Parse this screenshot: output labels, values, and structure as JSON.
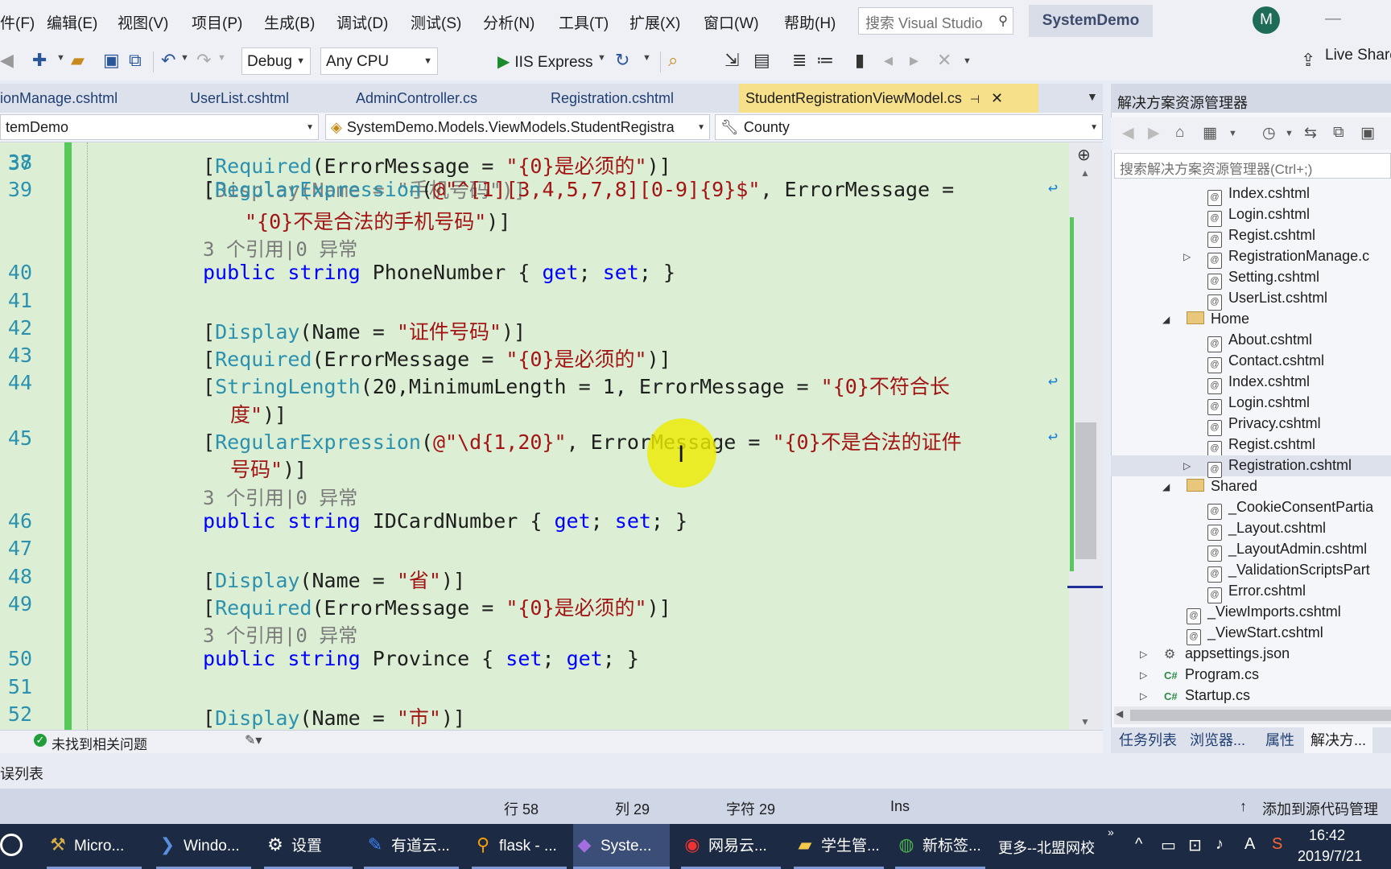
{
  "menu": {
    "items": [
      "件(F)",
      "编辑(E)",
      "视图(V)",
      "项目(P)",
      "生成(B)",
      "调试(D)",
      "测试(S)",
      "分析(N)",
      "工具(T)",
      "扩展(X)",
      "窗口(W)",
      "帮助(H)"
    ],
    "search_placeholder": "搜索 Visual Studio",
    "solution_name": "SystemDemo",
    "avatar_initial": "M"
  },
  "toolbar": {
    "config": "Debug",
    "platform": "Any CPU",
    "run_target": "IIS Express",
    "live_share": "Live Share"
  },
  "tabs": [
    {
      "label": "ionManage.cshtml",
      "active": false
    },
    {
      "label": "UserList.cshtml",
      "active": false
    },
    {
      "label": "AdminController.cs",
      "active": false
    },
    {
      "label": "Registration.cshtml",
      "active": false
    },
    {
      "label": "StudentRegistrationViewModel.cs",
      "active": true
    }
  ],
  "navbar": {
    "project": "temDemo",
    "type": "SystemDemo.Models.ViewModels.StudentRegistra",
    "member": "County"
  },
  "code": {
    "partial_top": "[Display(Name = \"手机号码\")]",
    "lines": [
      {
        "num": "38",
        "parts": [
          [
            "pl",
            "["
          ],
          [
            "attr",
            "Required"
          ],
          [
            "pl",
            "(ErrorMessage = "
          ],
          [
            "str",
            "\"{0}是必须的\""
          ],
          [
            "pl",
            ")]"
          ]
        ]
      },
      {
        "num": "39",
        "parts": [
          [
            "pl",
            "["
          ],
          [
            "attr",
            "RegularExpression"
          ],
          [
            "pl",
            "("
          ],
          [
            "str",
            "@\"^[1][3,4,5,7,8][0-9]{9}$\""
          ],
          [
            "pl",
            ", ErrorMessage = "
          ]
        ],
        "wrap": true
      },
      {
        "num": "",
        "cont": true,
        "indent": 278,
        "parts": [
          [
            "str",
            "\"{0}不是合法的手机号码\""
          ],
          [
            "pl",
            ")]"
          ]
        ]
      },
      {
        "lens": "3 个引用|0 异常"
      },
      {
        "num": "40",
        "parts": [
          [
            "kw",
            "public string "
          ],
          [
            "pl",
            "PhoneNumber { "
          ],
          [
            "kw",
            "get"
          ],
          [
            "pl",
            "; "
          ],
          [
            "kw",
            "set"
          ],
          [
            "pl",
            "; }"
          ]
        ]
      },
      {
        "num": "41",
        "parts": []
      },
      {
        "num": "42",
        "parts": [
          [
            "pl",
            "["
          ],
          [
            "attr",
            "Display"
          ],
          [
            "pl",
            "(Name = "
          ],
          [
            "str",
            "\"证件号码\""
          ],
          [
            "pl",
            ")]"
          ]
        ]
      },
      {
        "num": "43",
        "parts": [
          [
            "pl",
            "["
          ],
          [
            "attr",
            "Required"
          ],
          [
            "pl",
            "(ErrorMessage = "
          ],
          [
            "str",
            "\"{0}是必须的\""
          ],
          [
            "pl",
            ")]"
          ]
        ]
      },
      {
        "num": "44",
        "parts": [
          [
            "pl",
            "["
          ],
          [
            "attr",
            "StringLength"
          ],
          [
            "pl",
            "(20,MinimumLength = 1, ErrorMessage = "
          ],
          [
            "str",
            "\"{0}不符合长"
          ]
        ],
        "wrap": true
      },
      {
        "num": "",
        "cont": true,
        "indent": 260,
        "parts": [
          [
            "str",
            "度\""
          ],
          [
            "pl",
            ")]"
          ]
        ]
      },
      {
        "num": "45",
        "parts": [
          [
            "pl",
            "["
          ],
          [
            "attr",
            "RegularExpression"
          ],
          [
            "pl",
            "("
          ],
          [
            "str",
            "@\"\\d{1,20}\""
          ],
          [
            "pl",
            ", ErrorMessage = "
          ],
          [
            "str",
            "\"{0}不是合法的证件"
          ]
        ],
        "wrap": true
      },
      {
        "num": "",
        "cont": true,
        "indent": 260,
        "parts": [
          [
            "str",
            "号码\""
          ],
          [
            "pl",
            ")]"
          ]
        ]
      },
      {
        "lens": "3 个引用|0 异常"
      },
      {
        "num": "46",
        "parts": [
          [
            "kw",
            "public string "
          ],
          [
            "pl",
            "IDCardNumber { "
          ],
          [
            "kw",
            "get"
          ],
          [
            "pl",
            "; "
          ],
          [
            "kw",
            "set"
          ],
          [
            "pl",
            "; }"
          ]
        ]
      },
      {
        "num": "47",
        "parts": []
      },
      {
        "num": "48",
        "parts": [
          [
            "pl",
            "["
          ],
          [
            "attr",
            "Display"
          ],
          [
            "pl",
            "(Name = "
          ],
          [
            "str",
            "\"省\""
          ],
          [
            "pl",
            ")]"
          ]
        ]
      },
      {
        "num": "49",
        "parts": [
          [
            "pl",
            "["
          ],
          [
            "attr",
            "Required"
          ],
          [
            "pl",
            "(ErrorMessage = "
          ],
          [
            "str",
            "\"{0}是必须的\""
          ],
          [
            "pl",
            ")]"
          ]
        ]
      },
      {
        "lens": "3 个引用|0 异常"
      },
      {
        "num": "50",
        "parts": [
          [
            "kw",
            "public string "
          ],
          [
            "pl",
            "Province { "
          ],
          [
            "kw",
            "set"
          ],
          [
            "pl",
            "; "
          ],
          [
            "kw",
            "get"
          ],
          [
            "pl",
            "; }"
          ]
        ]
      },
      {
        "num": "51",
        "parts": []
      },
      {
        "num": "52",
        "parts": [
          [
            "pl",
            "["
          ],
          [
            "attr",
            "Display"
          ],
          [
            "pl",
            "(Name = "
          ],
          [
            "str",
            "\"市\""
          ],
          [
            "pl",
            ")]"
          ]
        ]
      }
    ]
  },
  "issues": {
    "text": "未找到相关问题"
  },
  "bottom_panel": {
    "title": "误列表"
  },
  "statusbar": {
    "line": "行 58",
    "col": "列 29",
    "char": "字符 29",
    "mode": "Ins",
    "source_control": "添加到源代码管理"
  },
  "solution_explorer": {
    "title": "解决方案资源管理器",
    "search_placeholder": "搜索解决方案资源管理器(Ctrl+;)",
    "items": [
      {
        "label": "Index.cshtml",
        "level": 3,
        "kind": "page"
      },
      {
        "label": "Login.cshtml",
        "level": 3,
        "kind": "page"
      },
      {
        "label": "Regist.cshtml",
        "level": 3,
        "kind": "page"
      },
      {
        "label": "RegistrationManage.c",
        "level": 3,
        "kind": "page",
        "expander": "collapsed"
      },
      {
        "label": "Setting.cshtml",
        "level": 3,
        "kind": "page"
      },
      {
        "label": "UserList.cshtml",
        "level": 3,
        "kind": "page"
      },
      {
        "label": "Home",
        "level": 2,
        "kind": "folder",
        "expander": "expanded"
      },
      {
        "label": "About.cshtml",
        "level": 3,
        "kind": "page"
      },
      {
        "label": "Contact.cshtml",
        "level": 3,
        "kind": "page"
      },
      {
        "label": "Index.cshtml",
        "level": 3,
        "kind": "page"
      },
      {
        "label": "Login.cshtml",
        "level": 3,
        "kind": "page"
      },
      {
        "label": "Privacy.cshtml",
        "level": 3,
        "kind": "page"
      },
      {
        "label": "Regist.cshtml",
        "level": 3,
        "kind": "page"
      },
      {
        "label": "Registration.cshtml",
        "level": 3,
        "kind": "page",
        "expander": "collapsed",
        "selected": true
      },
      {
        "label": "Shared",
        "level": 2,
        "kind": "folder",
        "expander": "expanded"
      },
      {
        "label": "_CookieConsentPartia",
        "level": 3,
        "kind": "page"
      },
      {
        "label": "_Layout.cshtml",
        "level": 3,
        "kind": "page"
      },
      {
        "label": "_LayoutAdmin.cshtml",
        "level": 3,
        "kind": "page"
      },
      {
        "label": "_ValidationScriptsPart",
        "level": 3,
        "kind": "page"
      },
      {
        "label": "Error.cshtml",
        "level": 3,
        "kind": "page"
      },
      {
        "label": "_ViewImports.cshtml",
        "level": 2,
        "kind": "page"
      },
      {
        "label": "_ViewStart.cshtml",
        "level": 2,
        "kind": "page"
      },
      {
        "label": "appsettings.json",
        "level": 1,
        "kind": "json",
        "expander": "collapsed"
      },
      {
        "label": "Program.cs",
        "level": 1,
        "kind": "cs",
        "expander": "collapsed"
      },
      {
        "label": "Startup.cs",
        "level": 1,
        "kind": "cs",
        "expander": "collapsed"
      }
    ],
    "bottom_tabs": [
      "任务列表",
      "浏览器...",
      "属性",
      "解决方..."
    ]
  },
  "taskbar": {
    "items": [
      {
        "label": "Micro...",
        "icon": "tools-icon"
      },
      {
        "label": "Windo...",
        "icon": "powershell-icon"
      },
      {
        "label": "设置",
        "icon": "gear-icon"
      },
      {
        "label": "有道云...",
        "icon": "note-icon"
      },
      {
        "label": "flask - ...",
        "icon": "search-icon"
      },
      {
        "label": "Syste...",
        "icon": "visual-studio-icon"
      },
      {
        "label": "网易云...",
        "icon": "music-icon"
      },
      {
        "label": "学生管...",
        "icon": "folder-icon"
      },
      {
        "label": "新标签...",
        "icon": "chrome-icon"
      }
    ],
    "more": "更多--北盟网校",
    "time": "16:42",
    "date": "2019/7/21"
  }
}
